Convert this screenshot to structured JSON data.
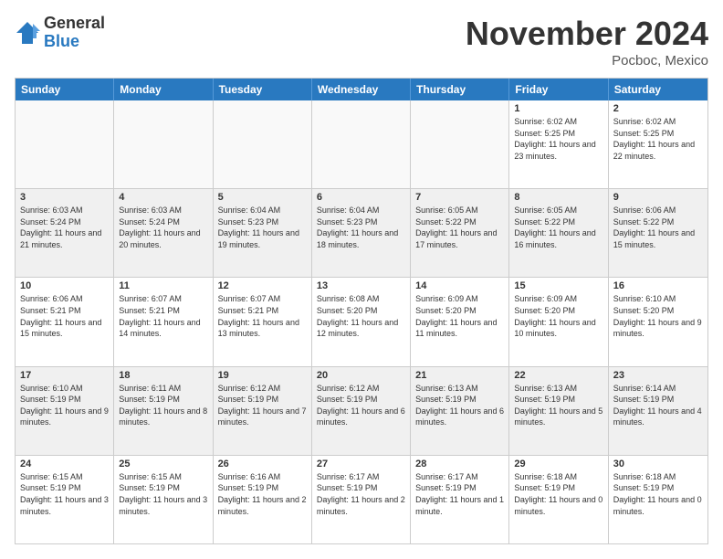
{
  "header": {
    "logo_general": "General",
    "logo_blue": "Blue",
    "month_title": "November 2024",
    "location": "Pocboc, Mexico"
  },
  "calendar": {
    "days_of_week": [
      "Sunday",
      "Monday",
      "Tuesday",
      "Wednesday",
      "Thursday",
      "Friday",
      "Saturday"
    ],
    "rows": [
      [
        {
          "day": "",
          "info": "",
          "empty": true
        },
        {
          "day": "",
          "info": "",
          "empty": true
        },
        {
          "day": "",
          "info": "",
          "empty": true
        },
        {
          "day": "",
          "info": "",
          "empty": true
        },
        {
          "day": "",
          "info": "",
          "empty": true
        },
        {
          "day": "1",
          "info": "Sunrise: 6:02 AM\nSunset: 5:25 PM\nDaylight: 11 hours and 23 minutes.",
          "empty": false
        },
        {
          "day": "2",
          "info": "Sunrise: 6:02 AM\nSunset: 5:25 PM\nDaylight: 11 hours and 22 minutes.",
          "empty": false
        }
      ],
      [
        {
          "day": "3",
          "info": "Sunrise: 6:03 AM\nSunset: 5:24 PM\nDaylight: 11 hours and 21 minutes.",
          "empty": false
        },
        {
          "day": "4",
          "info": "Sunrise: 6:03 AM\nSunset: 5:24 PM\nDaylight: 11 hours and 20 minutes.",
          "empty": false
        },
        {
          "day": "5",
          "info": "Sunrise: 6:04 AM\nSunset: 5:23 PM\nDaylight: 11 hours and 19 minutes.",
          "empty": false
        },
        {
          "day": "6",
          "info": "Sunrise: 6:04 AM\nSunset: 5:23 PM\nDaylight: 11 hours and 18 minutes.",
          "empty": false
        },
        {
          "day": "7",
          "info": "Sunrise: 6:05 AM\nSunset: 5:22 PM\nDaylight: 11 hours and 17 minutes.",
          "empty": false
        },
        {
          "day": "8",
          "info": "Sunrise: 6:05 AM\nSunset: 5:22 PM\nDaylight: 11 hours and 16 minutes.",
          "empty": false
        },
        {
          "day": "9",
          "info": "Sunrise: 6:06 AM\nSunset: 5:22 PM\nDaylight: 11 hours and 15 minutes.",
          "empty": false
        }
      ],
      [
        {
          "day": "10",
          "info": "Sunrise: 6:06 AM\nSunset: 5:21 PM\nDaylight: 11 hours and 15 minutes.",
          "empty": false
        },
        {
          "day": "11",
          "info": "Sunrise: 6:07 AM\nSunset: 5:21 PM\nDaylight: 11 hours and 14 minutes.",
          "empty": false
        },
        {
          "day": "12",
          "info": "Sunrise: 6:07 AM\nSunset: 5:21 PM\nDaylight: 11 hours and 13 minutes.",
          "empty": false
        },
        {
          "day": "13",
          "info": "Sunrise: 6:08 AM\nSunset: 5:20 PM\nDaylight: 11 hours and 12 minutes.",
          "empty": false
        },
        {
          "day": "14",
          "info": "Sunrise: 6:09 AM\nSunset: 5:20 PM\nDaylight: 11 hours and 11 minutes.",
          "empty": false
        },
        {
          "day": "15",
          "info": "Sunrise: 6:09 AM\nSunset: 5:20 PM\nDaylight: 11 hours and 10 minutes.",
          "empty": false
        },
        {
          "day": "16",
          "info": "Sunrise: 6:10 AM\nSunset: 5:20 PM\nDaylight: 11 hours and 9 minutes.",
          "empty": false
        }
      ],
      [
        {
          "day": "17",
          "info": "Sunrise: 6:10 AM\nSunset: 5:19 PM\nDaylight: 11 hours and 9 minutes.",
          "empty": false
        },
        {
          "day": "18",
          "info": "Sunrise: 6:11 AM\nSunset: 5:19 PM\nDaylight: 11 hours and 8 minutes.",
          "empty": false
        },
        {
          "day": "19",
          "info": "Sunrise: 6:12 AM\nSunset: 5:19 PM\nDaylight: 11 hours and 7 minutes.",
          "empty": false
        },
        {
          "day": "20",
          "info": "Sunrise: 6:12 AM\nSunset: 5:19 PM\nDaylight: 11 hours and 6 minutes.",
          "empty": false
        },
        {
          "day": "21",
          "info": "Sunrise: 6:13 AM\nSunset: 5:19 PM\nDaylight: 11 hours and 6 minutes.",
          "empty": false
        },
        {
          "day": "22",
          "info": "Sunrise: 6:13 AM\nSunset: 5:19 PM\nDaylight: 11 hours and 5 minutes.",
          "empty": false
        },
        {
          "day": "23",
          "info": "Sunrise: 6:14 AM\nSunset: 5:19 PM\nDaylight: 11 hours and 4 minutes.",
          "empty": false
        }
      ],
      [
        {
          "day": "24",
          "info": "Sunrise: 6:15 AM\nSunset: 5:19 PM\nDaylight: 11 hours and 3 minutes.",
          "empty": false
        },
        {
          "day": "25",
          "info": "Sunrise: 6:15 AM\nSunset: 5:19 PM\nDaylight: 11 hours and 3 minutes.",
          "empty": false
        },
        {
          "day": "26",
          "info": "Sunrise: 6:16 AM\nSunset: 5:19 PM\nDaylight: 11 hours and 2 minutes.",
          "empty": false
        },
        {
          "day": "27",
          "info": "Sunrise: 6:17 AM\nSunset: 5:19 PM\nDaylight: 11 hours and 2 minutes.",
          "empty": false
        },
        {
          "day": "28",
          "info": "Sunrise: 6:17 AM\nSunset: 5:19 PM\nDaylight: 11 hours and 1 minute.",
          "empty": false
        },
        {
          "day": "29",
          "info": "Sunrise: 6:18 AM\nSunset: 5:19 PM\nDaylight: 11 hours and 0 minutes.",
          "empty": false
        },
        {
          "day": "30",
          "info": "Sunrise: 6:18 AM\nSunset: 5:19 PM\nDaylight: 11 hours and 0 minutes.",
          "empty": false
        }
      ]
    ]
  }
}
